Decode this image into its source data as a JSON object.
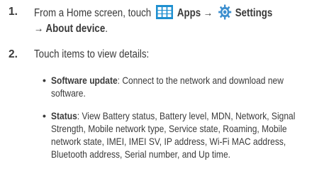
{
  "steps": [
    {
      "number": "1.",
      "text_a": "From a Home screen, touch ",
      "apps_label": "Apps",
      "arrow1": " → ",
      "settings_label": "Settings",
      "arrow2": "→ ",
      "about_label": "About device",
      "end": "."
    },
    {
      "number": "2.",
      "text": "Touch items to view details:"
    }
  ],
  "bullets": [
    {
      "term": "Software update",
      "lines": [
        ": Connect to the network and download new",
        "software."
      ]
    },
    {
      "term": "Status",
      "lines": [
        ": View Battery status, Battery level, MDN, Network, Signal",
        "Strength, Mobile network type, Service state, Roaming, Mobile",
        "network state, IMEI, IMEI SV, IP address, Wi-Fi MAC address,",
        "Bluetooth address, Serial number, and Up time."
      ]
    }
  ],
  "icons": {
    "apps": "apps-grid-icon",
    "settings": "settings-gear-icon"
  },
  "colors": {
    "text": "#3a3a3a",
    "apps_icon_bg": "#1f8fd0",
    "settings_icon": "#3d8fcf"
  }
}
